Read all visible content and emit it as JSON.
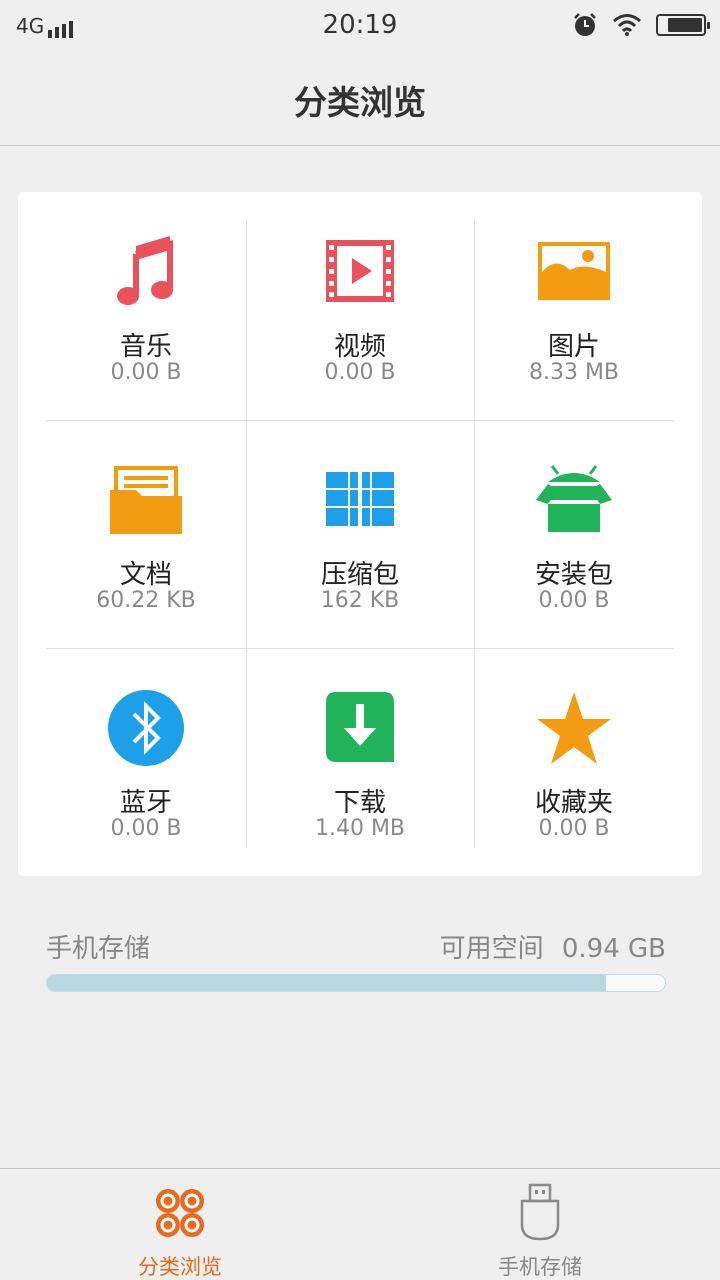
{
  "status_bar": {
    "network": "4G",
    "time": "20:19",
    "icons": [
      "signal-icon",
      "alarm-icon",
      "wifi-icon",
      "battery-icon"
    ]
  },
  "header": {
    "title": "分类浏览"
  },
  "categories": [
    {
      "label": "音乐",
      "size": "0.00 B",
      "icon": "music-note-icon",
      "color": "#e9525a"
    },
    {
      "label": "视频",
      "size": "0.00 B",
      "icon": "video-icon",
      "color": "#e9525a"
    },
    {
      "label": "图片",
      "size": "8.33 MB",
      "icon": "picture-icon",
      "color": "#f39c12"
    },
    {
      "label": "文档",
      "size": "60.22 KB",
      "icon": "folder-document-icon",
      "color": "#f39c12"
    },
    {
      "label": "压缩包",
      "size": "162 KB",
      "icon": "archive-icon",
      "color": "#1ea0e8"
    },
    {
      "label": "安装包",
      "size": "0.00 B",
      "icon": "android-package-icon",
      "color": "#22b45a"
    },
    {
      "label": "蓝牙",
      "size": "0.00 B",
      "icon": "bluetooth-icon",
      "color": "#1ea0e8"
    },
    {
      "label": "下载",
      "size": "1.40 MB",
      "icon": "download-icon",
      "color": "#22b45a"
    },
    {
      "label": "收藏夹",
      "size": "0.00 B",
      "icon": "star-icon",
      "color": "#f39c12"
    }
  ],
  "storage": {
    "title": "手机存储",
    "free_label": "可用空间",
    "free_value": "0.94 GB",
    "used_fraction": 0.905,
    "bar_color": "#b9d8e4"
  },
  "bottom_nav": [
    {
      "label": "分类浏览",
      "icon": "category-grid-icon",
      "active": true,
      "color": "#e86a1e"
    },
    {
      "label": "手机存储",
      "icon": "usb-storage-icon",
      "active": false,
      "color": "#888888"
    }
  ]
}
